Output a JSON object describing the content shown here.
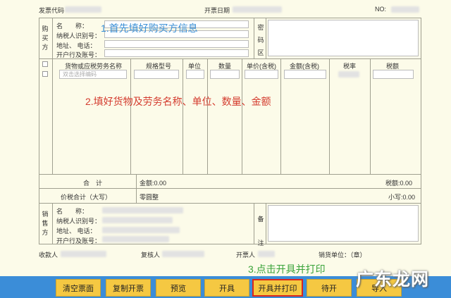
{
  "top": {
    "code_label": "发票代码",
    "date_label": "开票日期",
    "no_label": "NO:"
  },
  "buyer": {
    "side_label": [
      "购",
      "买",
      "方"
    ],
    "name_label": "名　　称：",
    "tax_id_label": "纳税人识别号：",
    "address_label": "地址、 电话：",
    "bank_label": "开户行及账号：",
    "secret_label": [
      "密",
      "码",
      "区"
    ]
  },
  "goods_table": {
    "headers": [
      "货物或应税劳务名称",
      "规格型号",
      "单位",
      "数量",
      "单价(含税)",
      "金额(含税)",
      "税率",
      "税额"
    ],
    "name_placeholder": "双击选择编码"
  },
  "totals": {
    "sum_label": "合　计",
    "amount_text": "金额:0.00",
    "tax_text": "税额:0.00",
    "total_label": "价税合计（大写）",
    "total_upper": "零圆整",
    "total_lower": "小写:0.00"
  },
  "seller": {
    "side_label": [
      "销",
      "售",
      "方"
    ],
    "name_label": "名　　称：",
    "tax_id_label": "纳税人识别号：",
    "address_label": "地址、 电话：",
    "bank_label": "开户行及账号：",
    "remark_label": [
      "备",
      "注"
    ]
  },
  "footer": {
    "payee_label": "收款人",
    "reviewer_label": "复核人",
    "issuer_label": "开票人",
    "seller_unit_label": "销货单位：（章）"
  },
  "annotations": {
    "step1": "1.首先填好购买方信息",
    "step2": "2.填好货物及劳务名称、单位、数量、金额",
    "step3": "3.点击开具并打印"
  },
  "buttons": [
    "清空票面",
    "复制开票",
    "预览",
    "开具",
    "开具并打印",
    "待开",
    "导入"
  ],
  "watermark": "广东龙网",
  "colors": {
    "accent_blue": "#3a8fd6",
    "annotation_red": "#d43c2f",
    "annotation_green": "#3aa33a",
    "button": "#f5c842",
    "highlight_border": "#d9261c"
  }
}
